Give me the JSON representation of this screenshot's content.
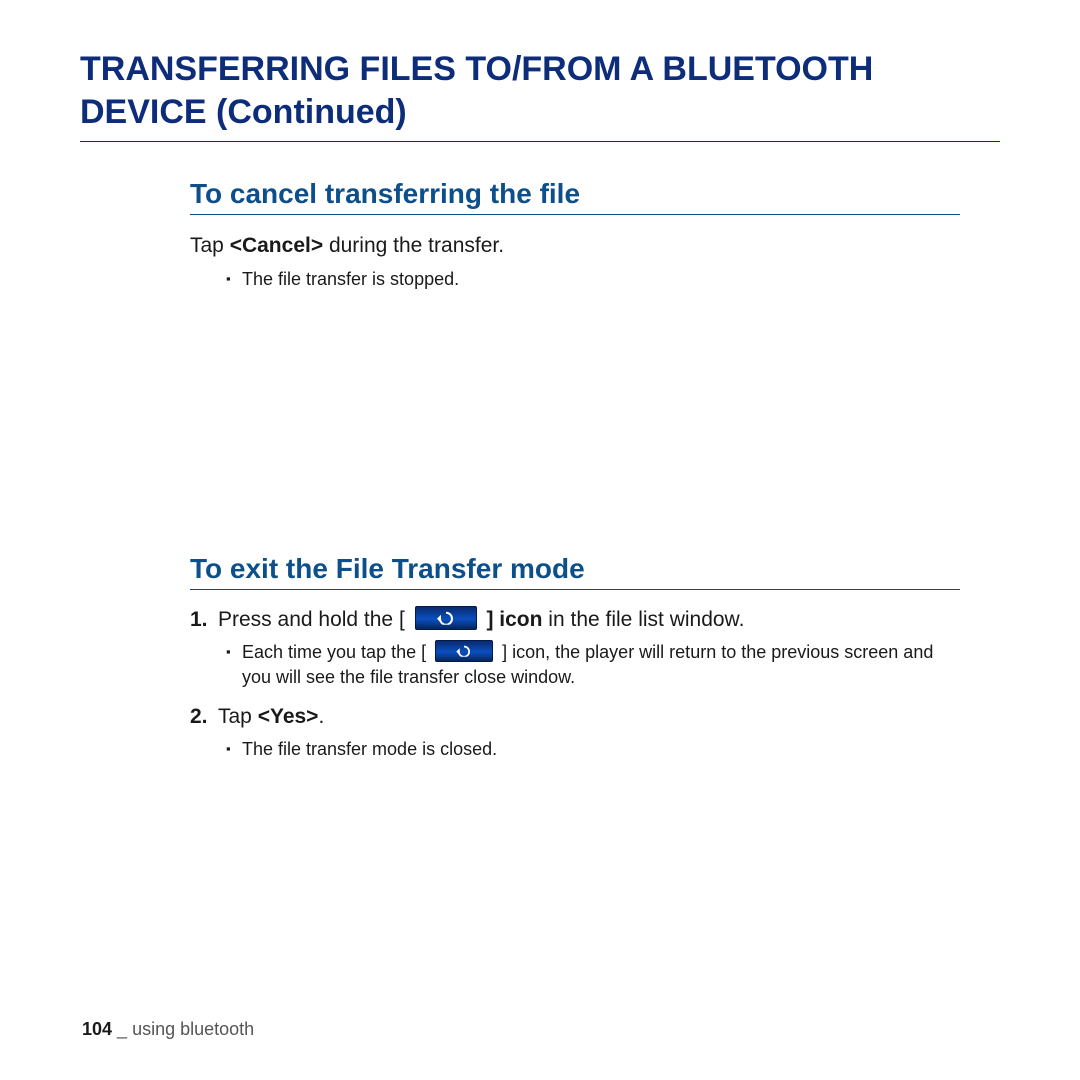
{
  "title": "TRANSFERRING FILES TO/FROM A BLUETOOTH DEVICE (Continued)",
  "section1": {
    "heading": "To cancel transferring the file",
    "line_pre": "Tap ",
    "line_bold": "<Cancel>",
    "line_post": " during the transfer.",
    "bullet1": "The file transfer is stopped."
  },
  "section2": {
    "heading": "To exit the File Transfer mode",
    "step1_num": "1.",
    "step1_pre": "Press and hold the [ ",
    "step1_mid_bold": " ] icon",
    "step1_post": " in the file list window.",
    "step1_sub_pre": "Each time you tap the [ ",
    "step1_sub_post": " ] icon, the player will return to the previous screen and you will see the file transfer close window.",
    "step2_num": "2.",
    "step2_pre": "Tap ",
    "step2_bold": "<Yes>",
    "step2_post": ".",
    "step2_sub": "The file transfer mode is closed."
  },
  "footer": {
    "page_number": "104",
    "separator": " _ ",
    "text": "using bluetooth"
  }
}
